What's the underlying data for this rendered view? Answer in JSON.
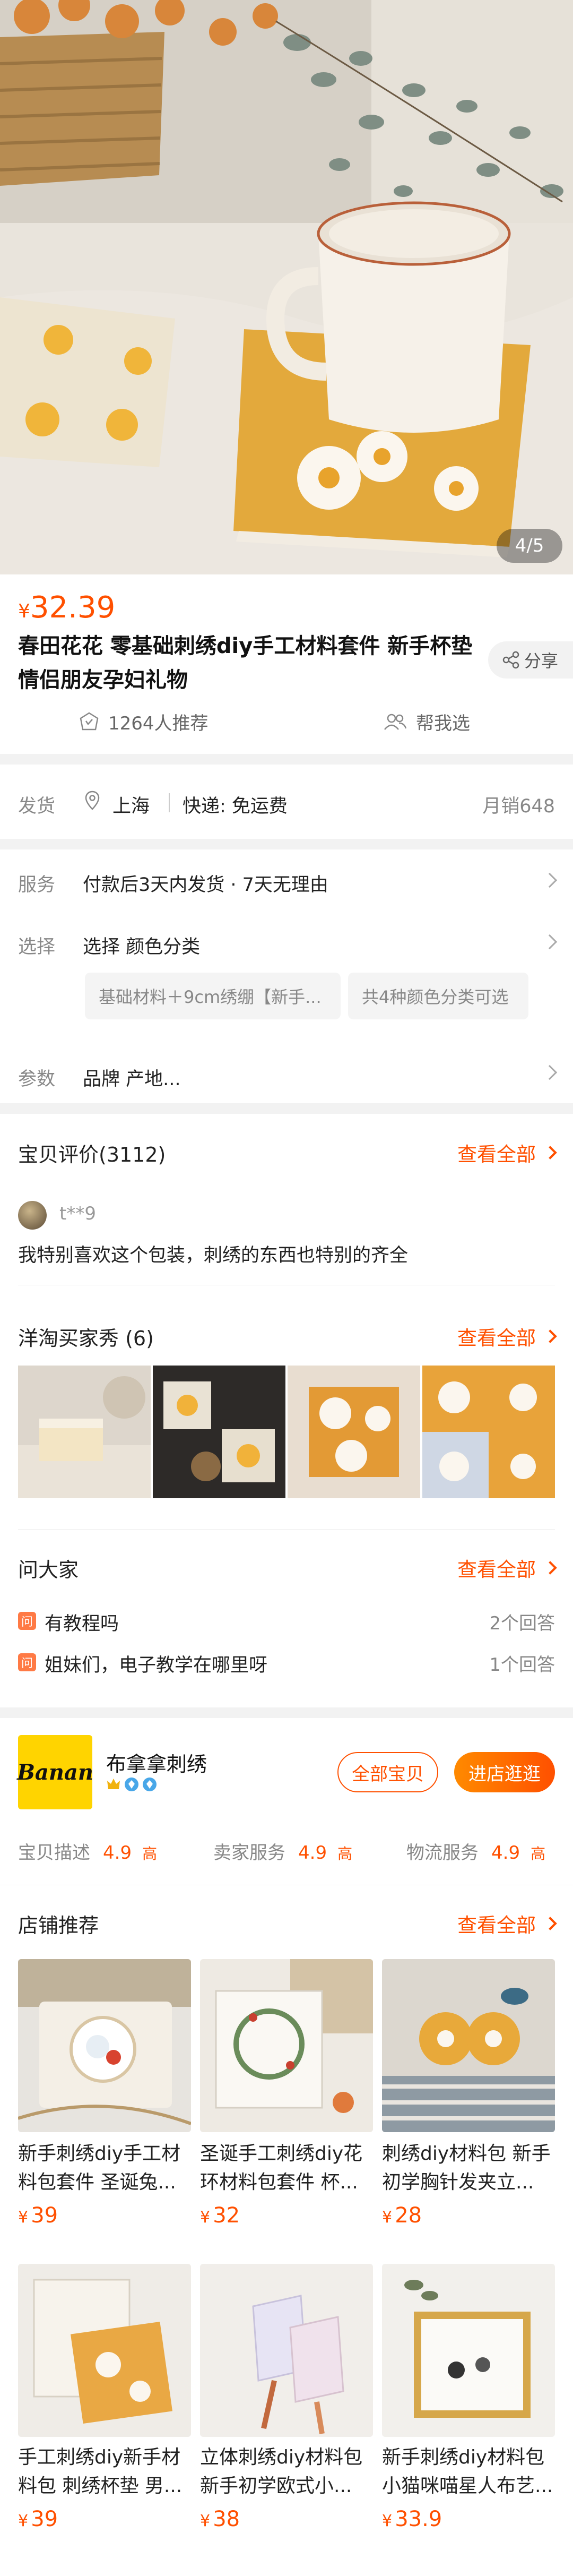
{
  "gallery": {
    "indicator": "4/5"
  },
  "product": {
    "currency": "¥",
    "price": "32.39",
    "title": "春田花花 零基础刺绣diy手工材料套件 新手杯垫 情侣朋友孕妇礼物",
    "share_label": "分享",
    "recommend_label": "1264人推荐",
    "help_label": "帮我选"
  },
  "shipping": {
    "label": "发货",
    "location": "上海",
    "express": "快递: 免运费",
    "monthly_sales": "月销648"
  },
  "service": {
    "label": "服务",
    "text": "付款后3天内发货 · 7天无理由"
  },
  "select": {
    "label": "选择",
    "text": "选择 颜色分类",
    "chips": [
      "基础材料＋9cm绣绷【新手...",
      "共4种颜色分类可选"
    ]
  },
  "params": {
    "label": "参数",
    "text": "品牌 产地..."
  },
  "reviews": {
    "title": "宝贝评价(3112)",
    "see_all": "查看全部",
    "reviewer": "t**9",
    "text": "我特别喜欢这个包装，刺绣的东西也特别的齐全"
  },
  "buyer_show": {
    "title": "洋淘买家秀 (6)",
    "see_all": "查看全部"
  },
  "ask": {
    "title": "问大家",
    "see_all": "查看全部",
    "icon_char": "问",
    "items": [
      {
        "q": "有教程吗",
        "count": "2个回答"
      },
      {
        "q": "姐妹们，电子教学在哪里呀",
        "count": "1个回答"
      }
    ]
  },
  "shop": {
    "logo_text": "Banan",
    "name": "布拿拿刺绣",
    "all_items_btn": "全部宝贝",
    "visit_btn": "进店逛逛",
    "scores": [
      {
        "label": "宝贝描述",
        "value": "4.9",
        "level": "高"
      },
      {
        "label": "卖家服务",
        "value": "4.9",
        "level": "高"
      },
      {
        "label": "物流服务",
        "value": "4.9",
        "level": "高"
      }
    ]
  },
  "store_rec": {
    "title": "店铺推荐",
    "see_all": "查看全部",
    "currency": "¥",
    "products": [
      {
        "title": "新手刺绣diy手工材料包套件 圣诞兔...",
        "price": "39"
      },
      {
        "title": "圣诞手工刺绣diy花环材料包套件 杯...",
        "price": "32"
      },
      {
        "title": "刺绣diy材料包 新手初学胸针发夹立...",
        "price": "28"
      },
      {
        "title": "手工刺绣diy新手材料包 刺绣杯垫 男...",
        "price": "39"
      },
      {
        "title": "立体刺绣diy材料包 新手初学欧式小...",
        "price": "38"
      },
      {
        "title": "新手刺绣diy材料包 小猫咪喵星人布艺...",
        "price": "33.9"
      }
    ]
  },
  "colors": {
    "accent": "#ff5000",
    "background": "#f2f2f2"
  }
}
